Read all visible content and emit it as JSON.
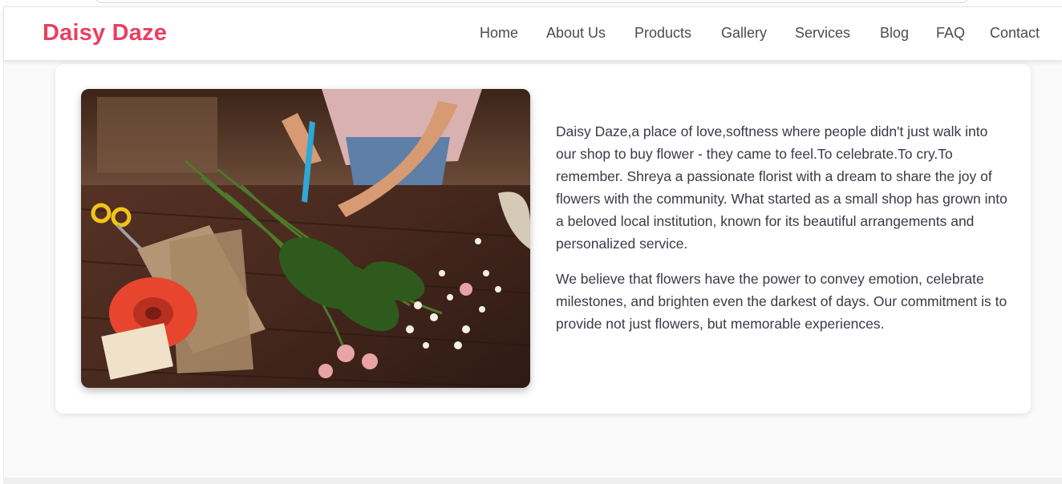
{
  "brand": {
    "name": "Daisy Daze",
    "color": "#ea3f62"
  },
  "nav": {
    "items": [
      {
        "label": "Home"
      },
      {
        "label": "About Us"
      },
      {
        "label": "Products"
      },
      {
        "label": "Gallery"
      },
      {
        "label": "Services"
      },
      {
        "label": "Blog"
      },
      {
        "label": "FAQ"
      },
      {
        "label": "Contact"
      }
    ]
  },
  "about": {
    "paragraph_1": "Daisy Daze,a place of love,softness where people didn't just walk into our shop to buy flower - they came to feel.To celebrate.To cry.To remember. Shreya a passionate florist with a dream to share the joy of flowers with the community. What started as a small shop has grown into a beloved local institution, known for its beautiful arrangements and personalized service.",
    "paragraph_2": "We believe that flowers have the power to convey emotion, celebrate milestones, and brighten even the darkest of days. Our commitment is to provide not just flowers, but memorable experiences."
  }
}
